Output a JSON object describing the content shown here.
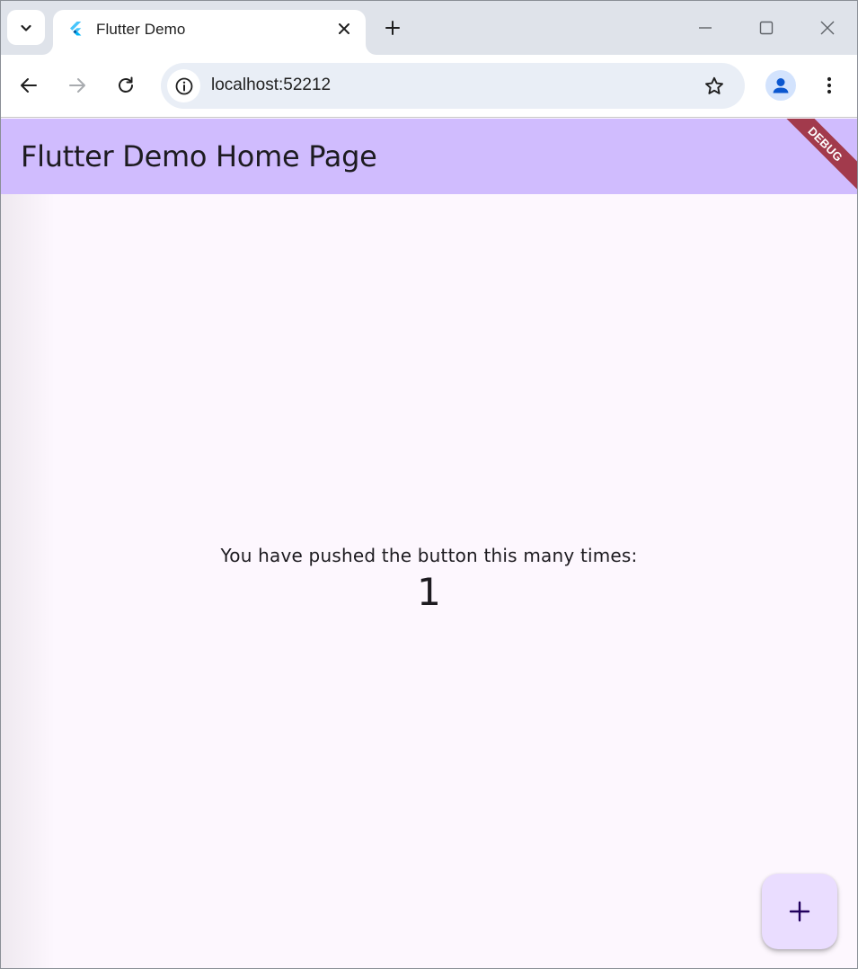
{
  "browser": {
    "tab": {
      "title": "Flutter Demo"
    },
    "omnibox": {
      "url": "localhost:52212"
    }
  },
  "app": {
    "appbar_title": "Flutter Demo Home Page",
    "debug_banner": "DEBUG",
    "counter_label": "You have pushed the button this many times:",
    "counter_value": "1",
    "fab_icon": "add-icon"
  },
  "colors": {
    "appbar": "#d0bcfe",
    "page_background": "#fdf7fe",
    "fab": "#eaddff",
    "debug_banner": "#a23a4c",
    "tabstrip": "#dfe3ea",
    "omnibox": "#e9eef6"
  }
}
